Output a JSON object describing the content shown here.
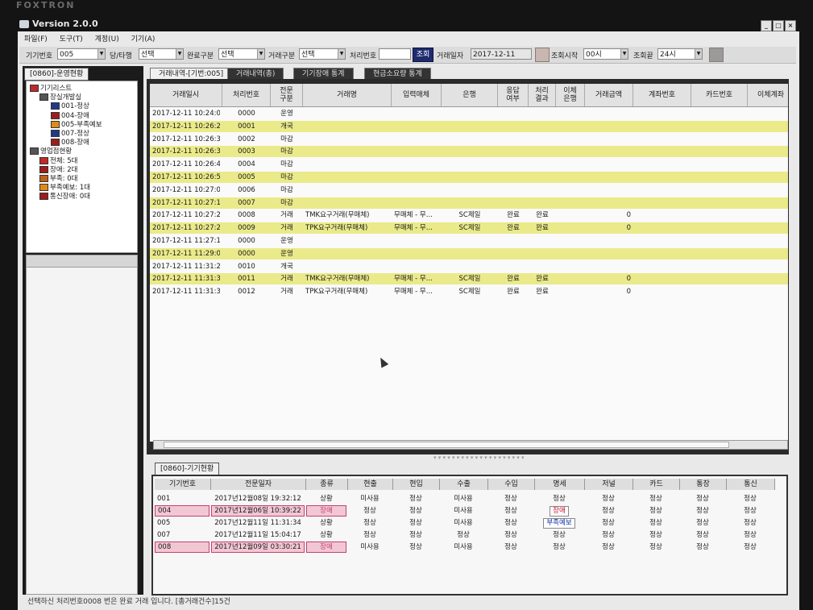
{
  "app": {
    "brand": "FOXTRON",
    "title": "Version 2.0.0"
  },
  "window_buttons": [
    "_",
    "□",
    "×"
  ],
  "menu": [
    "파일(F)",
    "도구(T)",
    "계정(U)",
    "기기(A)"
  ],
  "toolbar": {
    "device_no_label": "기기번호",
    "device_no_value": "005",
    "own_other_label": "당/타행",
    "own_other_value": "선택",
    "complete_label": "완료구분",
    "complete_value": "선택",
    "trade_type_label": "거래구분",
    "trade_type_value": "선택",
    "proc_no_label": "처리번호",
    "proc_no_value": "",
    "search_button": "조회",
    "trade_date_label": "거래일자",
    "trade_date_value": "2017-12-11",
    "start_label": "조회시작",
    "start_value": "00시",
    "end_label": "조회끝",
    "end_value": "24시"
  },
  "left": {
    "tab": "[0860]-운영현황",
    "tree": [
      {
        "label": "기기리스트",
        "icon": "device-list-icon",
        "color": "#c02a2a"
      },
      {
        "label": "장실개발실",
        "icon": "group-icon",
        "color": "#555555"
      },
      {
        "label": "001-정상",
        "icon": "device-normal-icon",
        "color": "#1e3a8a"
      },
      {
        "label": "004-장애",
        "icon": "device-error-icon",
        "color": "#a11b1b"
      },
      {
        "label": "005-부족예보",
        "icon": "device-warning-icon",
        "color": "#e08a1a"
      },
      {
        "label": "007-정상",
        "icon": "device-normal-icon",
        "color": "#1e3a8a"
      },
      {
        "label": "008-장애",
        "icon": "device-error-icon",
        "color": "#a11b1b"
      },
      {
        "label": "영업점현황",
        "icon": "branch-icon",
        "color": "#555555"
      },
      {
        "label": "전체: 5대",
        "icon": "all-icon",
        "color": "#c02a2a"
      },
      {
        "label": "장애: 2대",
        "icon": "error-icon",
        "color": "#a11b1b"
      },
      {
        "label": "부족: 0대",
        "icon": "shortage-icon",
        "color": "#c0611a"
      },
      {
        "label": "부족예보: 1대",
        "icon": "warning-icon",
        "color": "#e08a1a"
      },
      {
        "label": "통신장애: 0대",
        "icon": "comm-error-icon",
        "color": "#a11b1b"
      }
    ]
  },
  "tabs": [
    "거래내역-[기번:005]",
    "거래내역(총)",
    "기기장애 통계",
    "현금소요량 통계"
  ],
  "grid": {
    "headers": [
      "거래일시",
      "처리번호",
      "전문\n구분",
      "거래명",
      "입력매체",
      "은행",
      "응답\n여부",
      "처리\n결과",
      "이체\n은행",
      "거래금액",
      "계좌번호",
      "카드번호",
      "이체계좌"
    ],
    "rows": [
      [
        "2017-12-11 10:24:0...",
        "0000",
        "운영",
        "",
        "",
        "",
        "",
        "",
        "",
        "",
        "",
        "",
        ""
      ],
      [
        "2017-12-11 10:26:2...",
        "0001",
        "개국",
        "",
        "",
        "",
        "",
        "",
        "",
        "",
        "",
        "",
        ""
      ],
      [
        "2017-12-11 10:26:3...",
        "0002",
        "마감",
        "",
        "",
        "",
        "",
        "",
        "",
        "",
        "",
        "",
        ""
      ],
      [
        "2017-12-11 10:26:3...",
        "0003",
        "마감",
        "",
        "",
        "",
        "",
        "",
        "",
        "",
        "",
        "",
        ""
      ],
      [
        "2017-12-11 10:26:4...",
        "0004",
        "마감",
        "",
        "",
        "",
        "",
        "",
        "",
        "",
        "",
        "",
        ""
      ],
      [
        "2017-12-11 10:26:5...",
        "0005",
        "마감",
        "",
        "",
        "",
        "",
        "",
        "",
        "",
        "",
        "",
        ""
      ],
      [
        "2017-12-11 10:27:0...",
        "0006",
        "마감",
        "",
        "",
        "",
        "",
        "",
        "",
        "",
        "",
        "",
        ""
      ],
      [
        "2017-12-11 10:27:1...",
        "0007",
        "마감",
        "",
        "",
        "",
        "",
        "",
        "",
        "",
        "",
        "",
        ""
      ],
      [
        "2017-12-11 10:27:2...",
        "0008",
        "거래",
        "TMK요구거래(무매체)",
        "무매체 - 무...",
        "SC제일",
        "완료",
        "완료",
        "",
        "0",
        "",
        "",
        ""
      ],
      [
        "2017-12-11 10:27:2...",
        "0009",
        "거래",
        "TPK요구거래(무매체)",
        "무매체 - 무...",
        "SC제일",
        "완료",
        "완료",
        "",
        "0",
        "",
        "",
        ""
      ],
      [
        "2017-12-11 11:27:1...",
        "0000",
        "운영",
        "",
        "",
        "",
        "",
        "",
        "",
        "",
        "",
        "",
        ""
      ],
      [
        "2017-12-11 11:29:0...",
        "0000",
        "운영",
        "",
        "",
        "",
        "",
        "",
        "",
        "",
        "",
        "",
        ""
      ],
      [
        "2017-12-11 11:31:2...",
        "0010",
        "개국",
        "",
        "",
        "",
        "",
        "",
        "",
        "",
        "",
        "",
        ""
      ],
      [
        "2017-12-11 11:31:3...",
        "0011",
        "거래",
        "TMK요구거래(무매체)",
        "무매체 - 무...",
        "SC제일",
        "완료",
        "완료",
        "",
        "0",
        "",
        "",
        ""
      ],
      [
        "2017-12-11 11:31:3...",
        "0012",
        "거래",
        "TPK요구거래(무매체)",
        "무매체 - 무...",
        "SC제일",
        "완료",
        "완료",
        "",
        "0",
        "",
        "",
        ""
      ]
    ],
    "highlight_color": "#eaea8a"
  },
  "device_status": {
    "tab": "[0860]-기기현황",
    "headers": [
      "기기번호",
      "전문일자",
      "종류",
      "현출",
      "현입",
      "수출",
      "수입",
      "명세",
      "저널",
      "카드",
      "통장",
      "통신"
    ],
    "rows": [
      {
        "cells": [
          "001",
          "2017년12월08일 19:32:12",
          "상황",
          "미사용",
          "정상",
          "미사용",
          "정상",
          "정상",
          "정상",
          "정상",
          "정상",
          "정상"
        ],
        "alert": false,
        "badge": ""
      },
      {
        "cells": [
          "004",
          "2017년12월06일 10:39:22",
          "장애",
          "정상",
          "정상",
          "미사용",
          "정상",
          "장애",
          "정상",
          "정상",
          "정상",
          "정상"
        ],
        "alert": true,
        "badge": "red"
      },
      {
        "cells": [
          "005",
          "2017년12월11일 11:31:34",
          "상황",
          "정상",
          "정상",
          "미사용",
          "정상",
          "부족예보",
          "정상",
          "정상",
          "정상",
          "정상"
        ],
        "alert": false,
        "badge": "blue"
      },
      {
        "cells": [
          "007",
          "2017년12월11일 15:04:17",
          "상황",
          "정상",
          "정상",
          "정상",
          "정상",
          "정상",
          "정상",
          "정상",
          "정상",
          "정상"
        ],
        "alert": false,
        "badge": ""
      },
      {
        "cells": [
          "008",
          "2017년12월09일 03:30:21",
          "장애",
          "미사용",
          "정상",
          "미사용",
          "정상",
          "정상",
          "정상",
          "정상",
          "정상",
          "정상"
        ],
        "alert": true,
        "badge": ""
      }
    ]
  },
  "status_bar": "선택하신 처리번호0008 번은 완료 거래 입니다. [총거래건수]15건"
}
